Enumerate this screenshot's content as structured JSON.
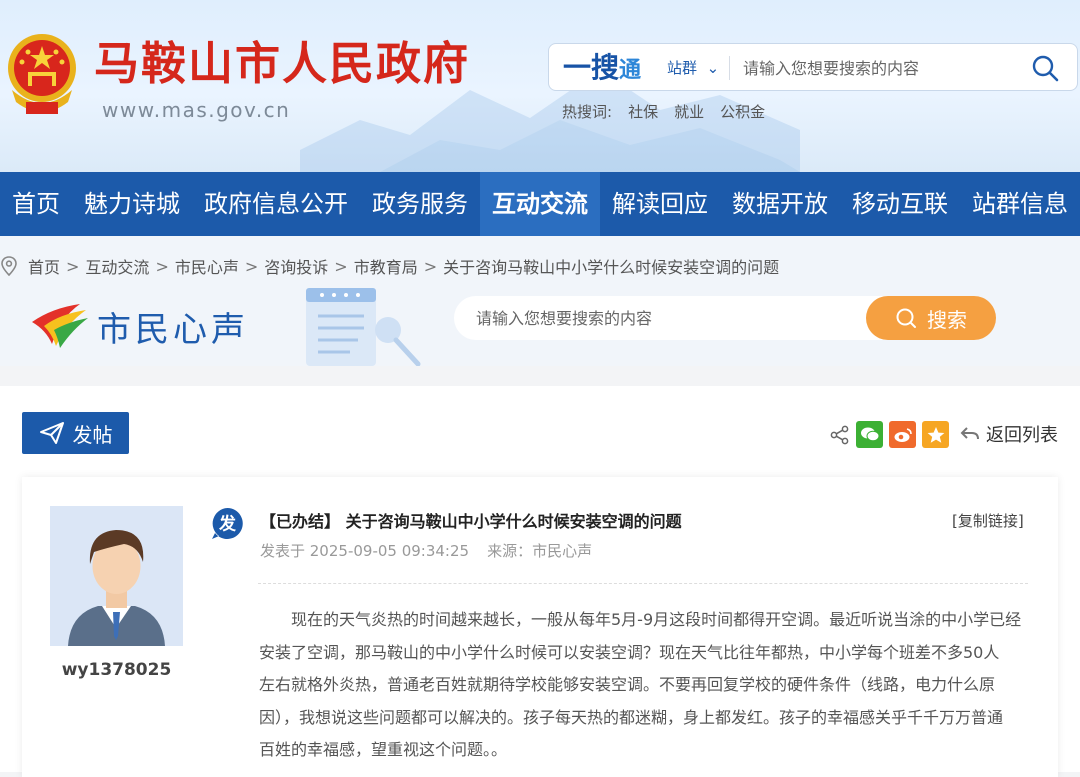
{
  "header": {
    "site_title": "马鞍山市人民政府",
    "site_url": "www.mas.gov.cn",
    "search_brand": "一搜",
    "search_brand_suffix": "通",
    "search_scope": "站群",
    "search_placeholder": "请输入您想要搜索的内容",
    "hot_label": "热搜词:",
    "hot_words": [
      "社保",
      "就业",
      "公积金"
    ]
  },
  "nav": {
    "items": [
      "首页",
      "魅力诗城",
      "政府信息公开",
      "政务服务",
      "互动交流",
      "解读回应",
      "数据开放",
      "移动互联",
      "站群信息"
    ],
    "active": "互动交流"
  },
  "breadcrumb": [
    "首页",
    "互动交流",
    "市民心声",
    "咨询投诉",
    "市教育局",
    "关于咨询马鞍山中小学什么时候安装空调的问题"
  ],
  "section": {
    "title": "市民心声",
    "search_placeholder": "请输入您想要搜索的内容",
    "search_button": "搜索"
  },
  "toolbar": {
    "post_button": "发帖",
    "back_label": "返回列表",
    "share_icons": [
      "share-icon",
      "wechat-icon",
      "weibo-icon",
      "favorite-icon"
    ]
  },
  "post": {
    "username": "wy1378025",
    "badge": "发",
    "status": "【已办结】",
    "title": "关于咨询马鞍山中小学什么时候安装空调的问题",
    "copy_link": "[复制链接]",
    "posted_at": "发表于 2025-09-05 09:34:25",
    "source": "来源：市民心声",
    "body_lines": [
      "　　现在的天气炎热的时间越来越长，一般从每年5月-9月这段时间都得开空调。最近听说当涂的中小学已经",
      "安装了空调，那马鞍山的中小学什么时候可以安装空调？现在天气比往年都热，中小学每个班差不多50人",
      "左右就格外炎热，普通老百姓就期待学校能够安装空调。不要再回复学校的硬件条件（线路，电力什么原",
      "因），我想说这些问题都可以解决的。孩子每天热的都迷糊，身上都发红。孩子的幸福感关乎千千万万普通",
      "百姓的幸福感，望重视这个问题。。"
    ]
  },
  "colors": {
    "primary_blue": "#1c5aaa",
    "title_red": "#d5271b",
    "search_orange": "#f5a041",
    "wechat_green": "#3cb034",
    "weibo_orange": "#f06a2c",
    "favorite_orange": "#f6a623"
  }
}
